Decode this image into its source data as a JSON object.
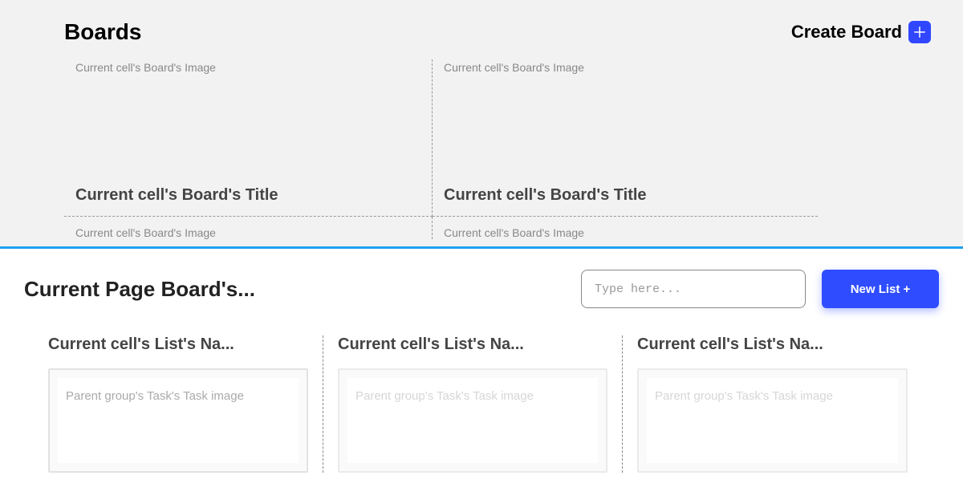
{
  "top": {
    "title": "Boards",
    "create_label": "Create Board",
    "cells": [
      {
        "image_label": "Current cell's Board's Image",
        "title_label": "Current cell's Board's Title"
      },
      {
        "image_label": "Current cell's Board's Image",
        "title_label": "Current cell's Board's Title"
      }
    ],
    "row2": [
      {
        "image_label": "Current cell's Board's Image"
      },
      {
        "image_label": "Current cell's Board's Image"
      }
    ]
  },
  "bottom": {
    "page_title": "Current Page Board's...",
    "search_placeholder": "Type here...",
    "new_list_label": "New List +",
    "lists": [
      {
        "name": "Current cell's List's Na...",
        "task_image_label": "Parent group's Task's Task image"
      },
      {
        "name": "Current cell's List's Na...",
        "task_image_label": "Parent group's Task's Task image"
      },
      {
        "name": "Current cell's List's Na...",
        "task_image_label": "Parent group's Task's Task image"
      }
    ]
  }
}
